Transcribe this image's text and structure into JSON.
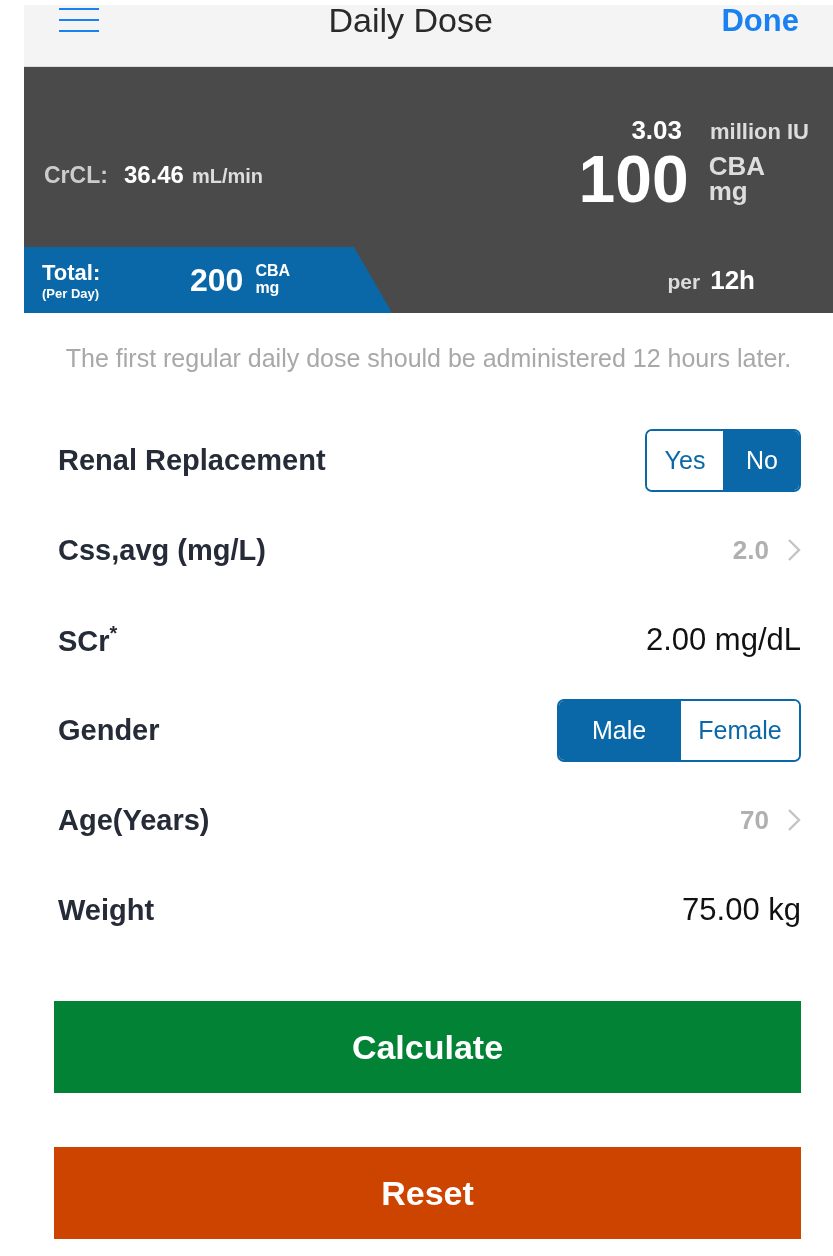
{
  "nav": {
    "title": "Daily Dose",
    "done": "Done"
  },
  "summary": {
    "crcl_label": "CrCL:",
    "crcl_value": "36.46",
    "crcl_unit": "mL/min",
    "iu_value": "3.03",
    "iu_unit": "million IU",
    "dose_value": "100",
    "dose_unit_1": "CBA",
    "dose_unit_2": "mg",
    "per_label": "per",
    "per_value": "12h",
    "total_label": "Total:",
    "total_sub": "(Per Day)",
    "total_value": "200",
    "total_unit_1": "CBA",
    "total_unit_2": "mg"
  },
  "message": "The first regular daily dose should be administered 12 hours later.",
  "rows": [
    {
      "kind": "toggle",
      "label": "Renal Replacement",
      "options": [
        {
          "label": "Yes",
          "selected": false
        },
        {
          "label": "No",
          "selected": true
        }
      ]
    },
    {
      "kind": "picker",
      "label": "Css,avg (mg/L)",
      "value": "2.0"
    },
    {
      "kind": "value",
      "label": "SCr$^{*}$",
      "value": "2.00 mg/dL"
    },
    {
      "kind": "toggle",
      "label": "Gender",
      "options": [
        {
          "label": "Male",
          "selected": true
        },
        {
          "label": "Female",
          "selected": false
        }
      ]
    },
    {
      "kind": "picker",
      "label": "Age(Years)",
      "value": "70"
    },
    {
      "kind": "value",
      "label": "Weight",
      "value": "75.00 kg"
    }
  ],
  "buttons": [
    {
      "kind": "calculate",
      "label": "Calculate"
    },
    {
      "kind": "reset",
      "label": "Reset"
    }
  ]
}
